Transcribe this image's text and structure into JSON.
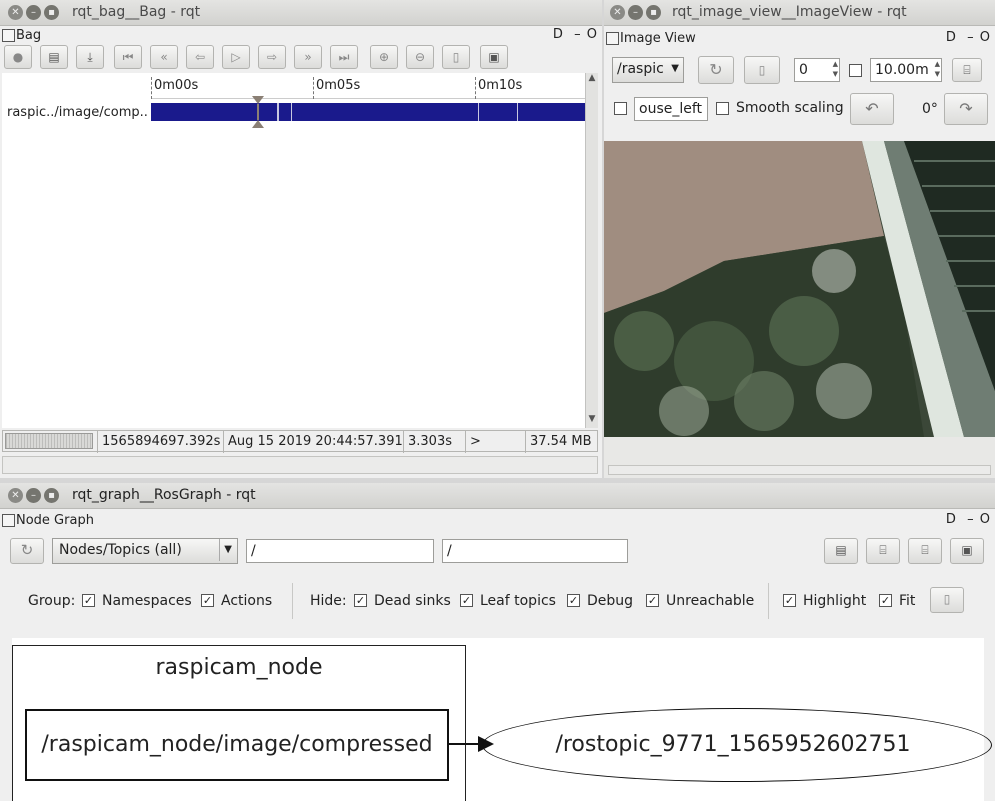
{
  "bag_window": {
    "title": "rqt_bag__Bag - rqt",
    "dock_title": "Bag",
    "dock_controls": "D  – O",
    "timeline": {
      "ticks": [
        "0m00s",
        "0m05s",
        "0m10s"
      ],
      "topic": "raspic../image/comp.."
    },
    "status": {
      "stamp": "1565894697.392s",
      "date": "Aug 15 2019 20:44:57.391",
      "elapsed": "3.303s",
      "play": ">",
      "size": "37.54 MB"
    }
  },
  "image_window": {
    "title": "rqt_image_view__ImageView - rqt",
    "dock_title": "Image View",
    "dock_controls": "D  – O",
    "topic_select": "/raspic",
    "spin_value": "0",
    "max_value": "10.00m",
    "mouse_topic": "ouse_left",
    "smooth_label": "Smooth scaling",
    "rotation": "0°"
  },
  "graph_window": {
    "title": "rqt_graph__RosGraph - rqt",
    "dock_title": "Node Graph",
    "dock_controls": "D  – O",
    "mode_select": "Nodes/Topics (all)",
    "filter1": "/",
    "filter2": "/",
    "group_label": "Group:",
    "namespaces_label": "Namespaces",
    "actions_label": "Actions",
    "hide_label": "Hide:",
    "dead_sinks_label": "Dead sinks",
    "leaf_topics_label": "Leaf topics",
    "debug_label": "Debug",
    "unreachable_label": "Unreachable",
    "highlight_label": "Highlight",
    "fit_label": "Fit",
    "node_cluster": "raspicam_node",
    "topic_box": "/raspicam_node/image/compressed",
    "sink_node": "/rostopic_9771_1565952602751"
  },
  "icons": {
    "close": "close-icon",
    "minimize": "minimize-icon",
    "maximize": "maximize-icon"
  }
}
